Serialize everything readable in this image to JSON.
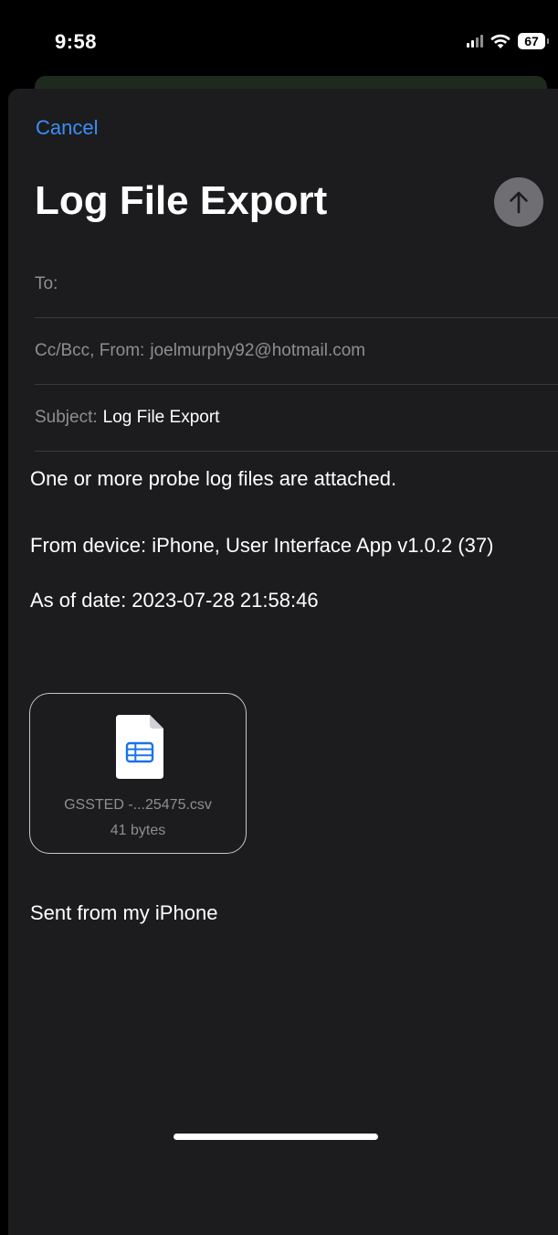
{
  "status_bar": {
    "time": "9:58",
    "battery_level": "67",
    "signal_bars_active": 2,
    "icons": [
      "signal-icon",
      "wifi-icon",
      "battery-icon"
    ]
  },
  "compose": {
    "cancel_label": "Cancel",
    "title": "Log File Export",
    "send_icon": "arrow-up-icon",
    "to_label": "To:",
    "to_value": "",
    "ccbcc_label": "Cc/Bcc, From:",
    "from_value": "joelmurphy92@hotmail.com",
    "subject_label": "Subject:",
    "subject_value": "Log File Export"
  },
  "body": {
    "line1": "One or more probe log files are attached.",
    "line2": "From device: iPhone, User Interface App v1.0.2 (37)",
    "line3": "As of date: 2023-07-28 21:58:46",
    "signature": "Sent from my iPhone"
  },
  "attachment": {
    "file_name": "GSSTED -...25475.csv",
    "file_size": "41 bytes",
    "icon": "spreadsheet-file-icon"
  },
  "colors": {
    "accent": "#3a8ff5",
    "sheet_background": "#1c1c1e",
    "send_button": "#6e6e73",
    "spreadsheet_icon": "#1a73e8"
  }
}
